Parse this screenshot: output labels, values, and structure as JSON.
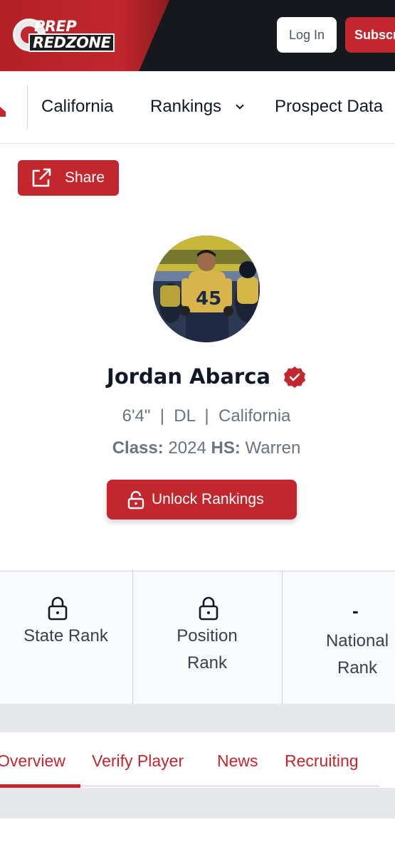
{
  "header": {
    "logo_line1": "PREP",
    "logo_line2": "REDZONE",
    "login_label": "Log In",
    "subscribe_label": "Subscribe"
  },
  "nav": {
    "items": [
      {
        "label": "California"
      },
      {
        "label": "Rankings"
      },
      {
        "label": "Prospect Data"
      }
    ]
  },
  "share": {
    "label": "Share"
  },
  "player": {
    "name": "Jordan Abarca",
    "height": "6'4\"",
    "position": "DL",
    "state": "California",
    "class_label": "Class:",
    "class_year": "2024",
    "hs_label": "HS:",
    "hs_name": "Warren",
    "jersey_number": "45"
  },
  "unlock": {
    "label": "Unlock Rankings"
  },
  "ranks": [
    {
      "label": "State Rank",
      "value_icon": "lock-icon"
    },
    {
      "label": "Position Rank",
      "value_icon": "lock-icon"
    },
    {
      "label": "National Rank",
      "value": "-"
    }
  ],
  "tabs": [
    {
      "label": "Overview",
      "active": true
    },
    {
      "label": "Verify Player"
    },
    {
      "label": "News"
    },
    {
      "label": "Recruiting"
    }
  ],
  "colors": {
    "brand_red": "#c1272d",
    "header_dark": "#15181d",
    "text_gray": "#6b7280"
  }
}
